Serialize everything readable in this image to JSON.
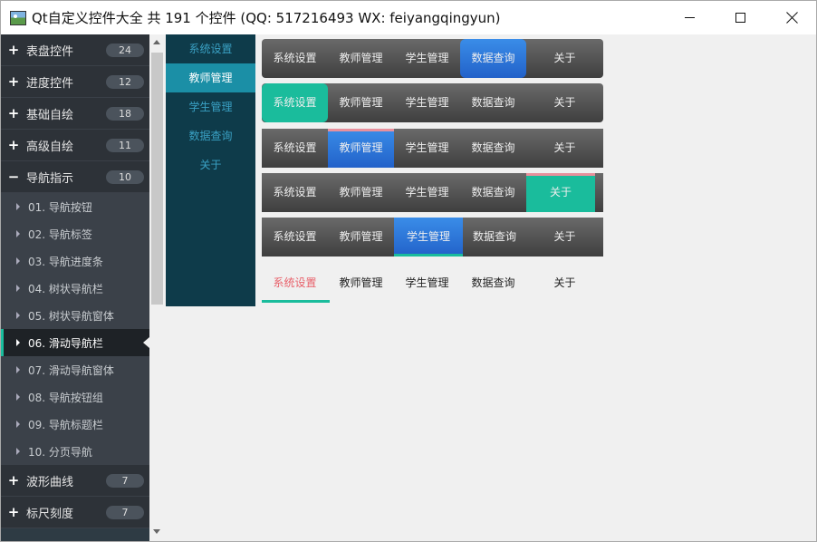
{
  "window": {
    "title": "Qt自定义控件大全 共 191 个控件 (QQ: 517216493 WX: feiyangqingyun)"
  },
  "sidebar": {
    "groups_top": [
      {
        "sign": "+",
        "label": "表盘控件",
        "count": "24"
      },
      {
        "sign": "+",
        "label": "进度控件",
        "count": "12"
      },
      {
        "sign": "+",
        "label": "基础自绘",
        "count": "18"
      },
      {
        "sign": "+",
        "label": "高级自绘",
        "count": "11"
      },
      {
        "sign": "−",
        "label": "导航指示",
        "count": "10"
      }
    ],
    "children": [
      "01. 导航按钮",
      "02. 导航标签",
      "03. 导航进度条",
      "04. 树状导航栏",
      "05. 树状导航窗体",
      "06. 滑动导航栏",
      "07. 滑动导航窗体",
      "08. 导航按钮组",
      "09. 导航标题栏",
      "10. 分页导航"
    ],
    "active_child_index": 5,
    "groups_bottom": [
      {
        "sign": "+",
        "label": "波形曲线",
        "count": "7"
      },
      {
        "sign": "+",
        "label": "标尺刻度",
        "count": "7"
      }
    ]
  },
  "nav_labels": [
    "系统设置",
    "教师管理",
    "学生管理",
    "数据查询",
    "关于"
  ],
  "vertical_nav": {
    "active_index": 1
  },
  "bars": [
    {
      "style": "rounded-blue",
      "active_index": 3
    },
    {
      "style": "rounded-teal",
      "active_index": 0
    },
    {
      "style": "flat-blue-topline",
      "active_index": 1
    },
    {
      "style": "flat-teal-topline",
      "active_index": 4
    },
    {
      "style": "flat-blue-underline",
      "active_index": 2
    },
    {
      "style": "text-underline",
      "active_index": 0
    }
  ],
  "colors": {
    "accent_teal": "#1abc9c",
    "accent_blue": "#2d7ae0",
    "active_text_red": "#e8606a",
    "sidebar_bg": "#2e3b44",
    "vertical_nav_bg": "#0e3b4a"
  },
  "icons": {
    "app": "app-landscape-icon",
    "minimize": "minimize-icon",
    "maximize": "maximize-icon",
    "close": "close-icon"
  }
}
